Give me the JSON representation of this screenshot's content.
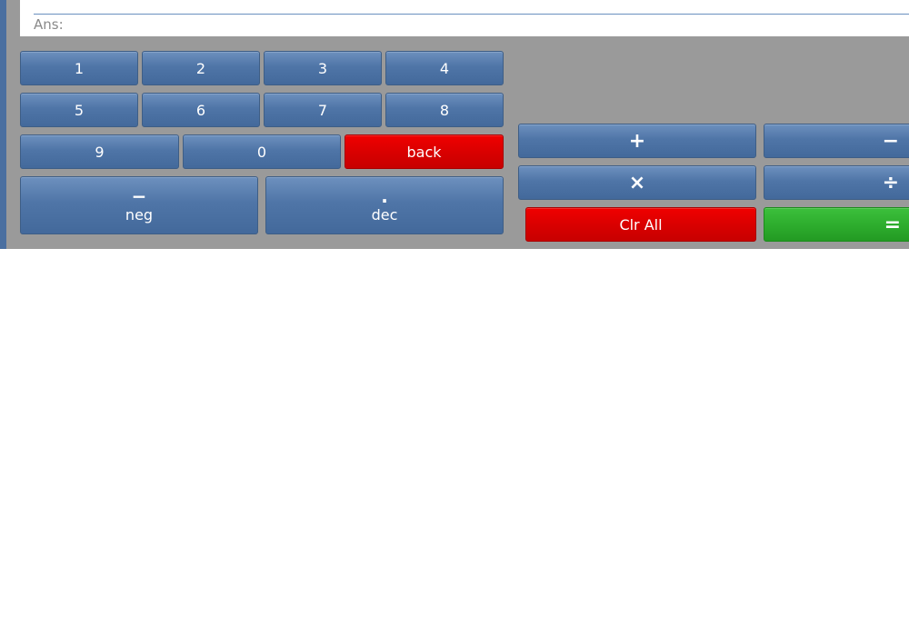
{
  "display": {
    "answer_label": "Ans:"
  },
  "keypad": {
    "digits": [
      "1",
      "2",
      "3",
      "4",
      "5",
      "6",
      "7",
      "8",
      "9",
      "0"
    ],
    "back_label": "back",
    "neg": {
      "symbol": "−",
      "label": "neg"
    },
    "dec": {
      "symbol": ".",
      "label": "dec"
    }
  },
  "operators": {
    "plus": "+",
    "minus": "−",
    "times": "×",
    "divide": "÷",
    "clear_all": "Clr All",
    "equals": "="
  },
  "colors": {
    "button_blue": "#4f75a7",
    "danger_red": "#da0000",
    "equals_green": "#2eae2e",
    "panel_gray": "#9a9a9a"
  }
}
